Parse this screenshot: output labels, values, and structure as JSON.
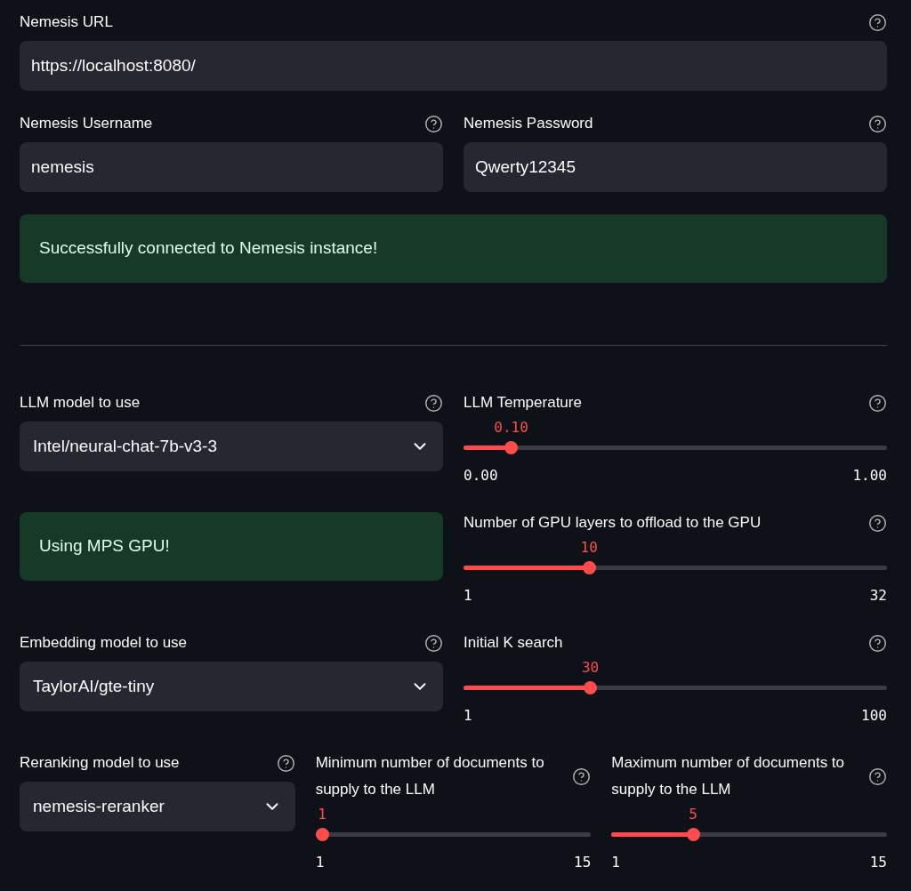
{
  "rows": [
    {
      "columns": [
        {
          "kind": "text_input",
          "label": "Nemesis URL",
          "value": "https://localhost:8080/",
          "help": true
        }
      ]
    },
    {
      "columns": [
        {
          "kind": "text_input",
          "label": "Nemesis Username",
          "value": "nemesis",
          "help": true
        },
        {
          "kind": "text_input",
          "label": "Nemesis Password",
          "value": "Qwerty12345",
          "help": true
        }
      ]
    },
    {
      "columns": [
        {
          "kind": "success",
          "text": "Successfully connected to Nemesis instance!"
        }
      ]
    },
    {
      "columns": [
        {
          "kind": "divider"
        }
      ]
    },
    {
      "columns": [
        {
          "kind": "select",
          "label": "LLM model to use",
          "value": "Intel/neural-chat-7b-v3-3",
          "help": true
        },
        {
          "kind": "slider",
          "label": "LLM Temperature",
          "value": "0.10",
          "min": "0.00",
          "max": "1.00",
          "level": 0.1,
          "help": true
        }
      ]
    },
    {
      "columns": [
        {
          "kind": "success",
          "text": "Using MPS GPU!"
        },
        {
          "kind": "slider",
          "label": "Number of GPU layers to offload to the GPU",
          "value": "10",
          "min": "1",
          "max": "32",
          "level": 0.29,
          "help": true
        }
      ]
    },
    {
      "columns": [
        {
          "kind": "select",
          "label": "Embedding model to use",
          "value": "TaylorAI/gte-tiny",
          "help": true
        },
        {
          "kind": "slider",
          "label": "Initial K search",
          "value": "30",
          "min": "1",
          "max": "100",
          "level": 0.293,
          "help": true
        }
      ]
    },
    {
      "columns": [
        {
          "kind": "select",
          "label": "Reranking model to use",
          "value": "nemesis-reranker",
          "help": true
        },
        {
          "kind": "slider",
          "label": "Minimum number of documents to supply to the LLM",
          "value": "1",
          "min": "1",
          "max": "15",
          "level": 0,
          "help": true
        },
        {
          "kind": "slider",
          "label": "Maximum number of documents to supply to the LLM",
          "value": "5",
          "min": "1",
          "max": "15",
          "level": 0.286,
          "help": true
        }
      ]
    }
  ]
}
